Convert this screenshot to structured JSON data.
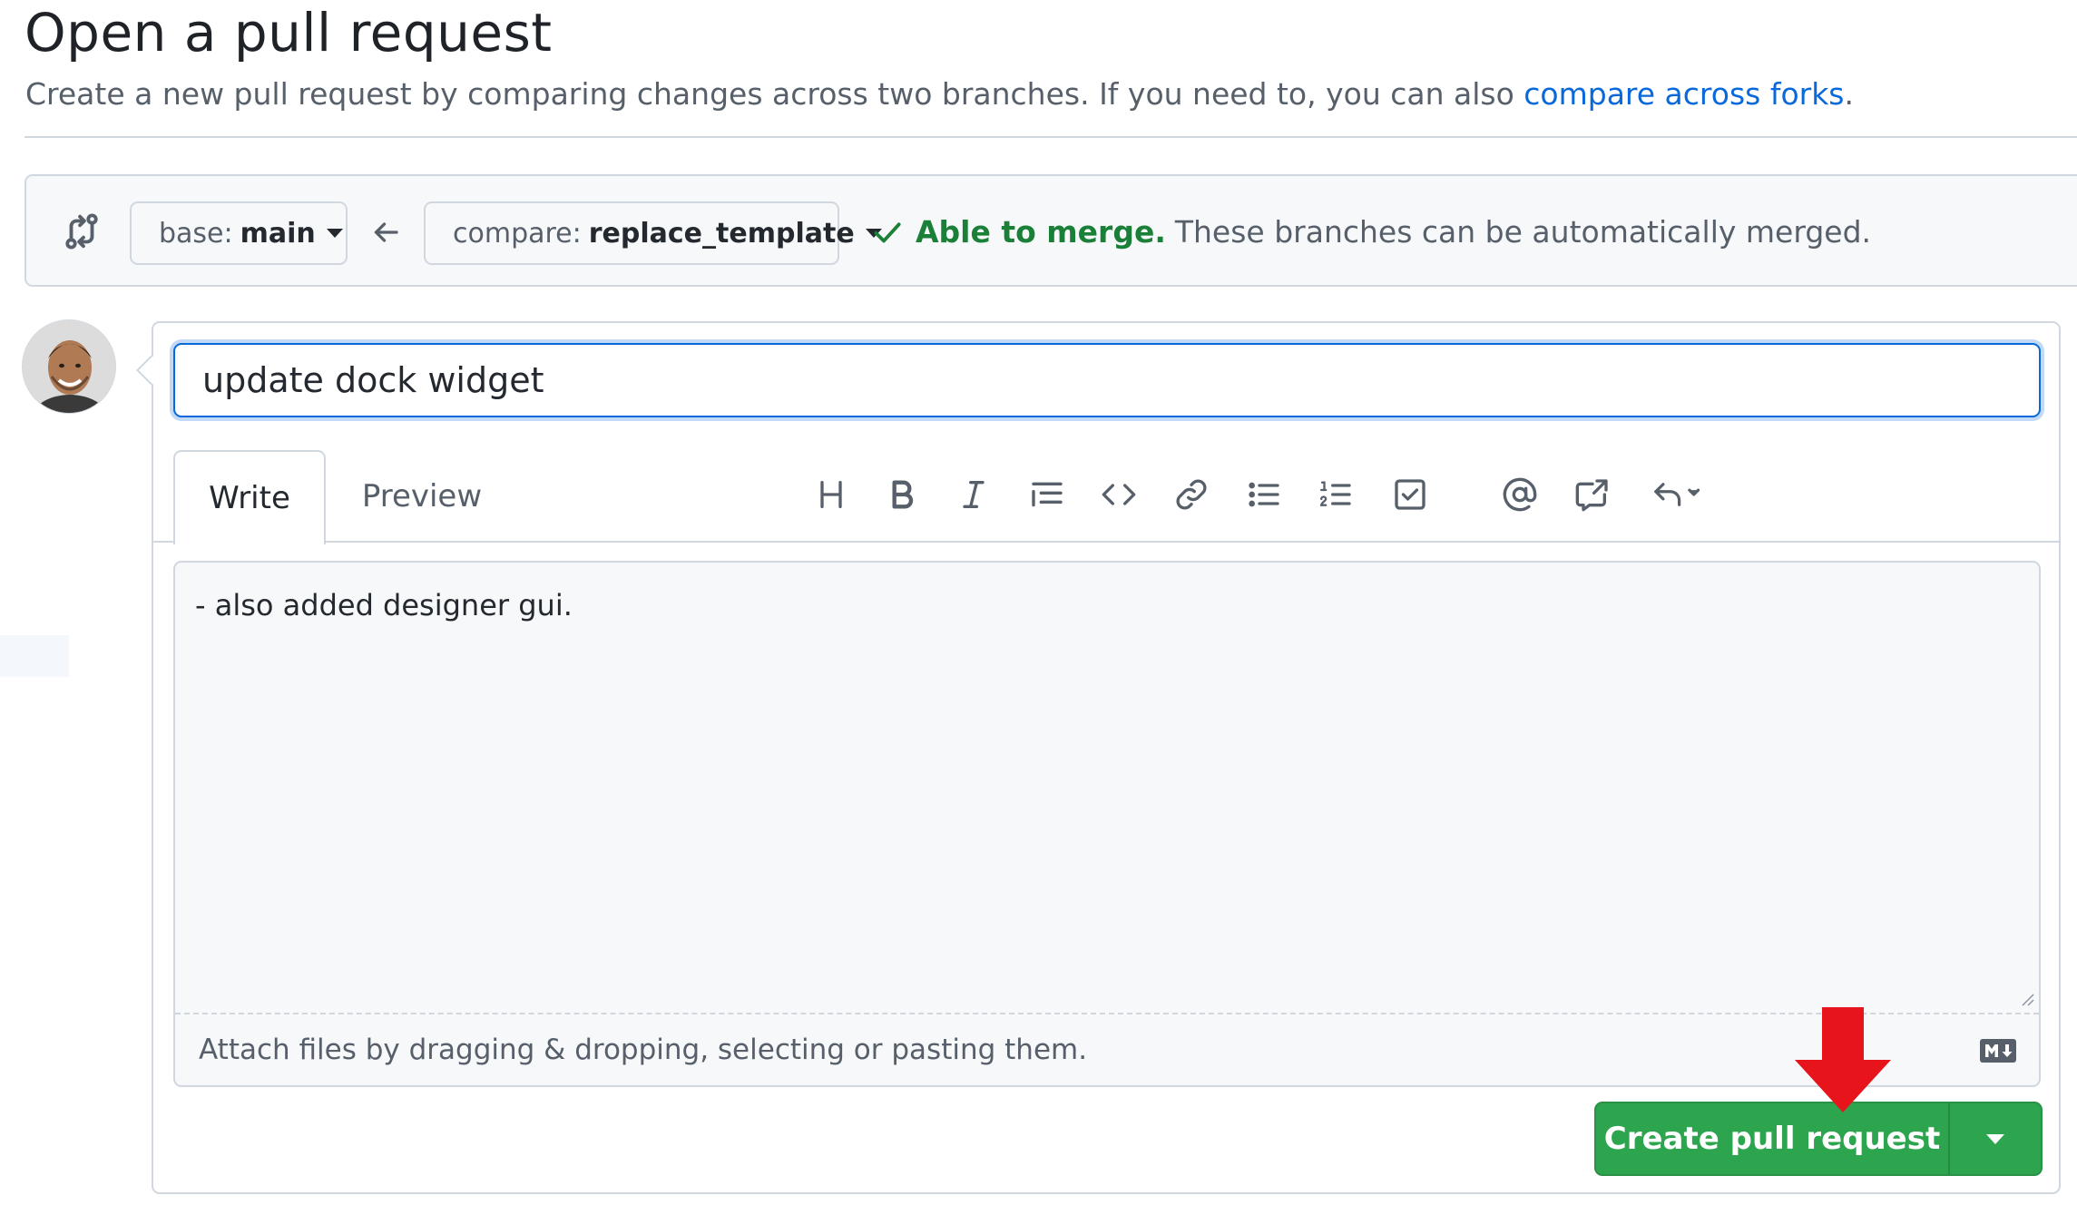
{
  "header": {
    "title": "Open a pull request",
    "subtitle_prefix": "Create a new pull request by comparing changes across two branches. If you need to, you can also ",
    "subtitle_link": "compare across forks",
    "subtitle_suffix": "."
  },
  "compare": {
    "base_label": "base:",
    "base_value": "main",
    "compare_label": "compare:",
    "compare_value": "replace_template",
    "merge_ok": "Able to merge.",
    "merge_text": "These branches can be automatically merged."
  },
  "form": {
    "title_value": "update dock widget",
    "tabs": [
      {
        "label": "Write",
        "active": true
      },
      {
        "label": "Preview",
        "active": false
      }
    ],
    "toolbar_icons": [
      "heading-icon",
      "bold-icon",
      "italic-icon",
      "quote-icon",
      "code-icon",
      "link-icon",
      "bulleted-list-icon",
      "numbered-list-icon",
      "task-list-icon",
      "mention-icon",
      "cross-reference-icon",
      "saved-replies-icon"
    ],
    "body_value": "- also added designer gui.",
    "attach_text": "Attach files by dragging & dropping, selecting or pasting them.",
    "submit_label": "Create pull request"
  },
  "colors": {
    "accent": "#0969da",
    "success": "#1a7f37",
    "button_green": "#2da44e",
    "annotation_red": "#e8141c"
  }
}
